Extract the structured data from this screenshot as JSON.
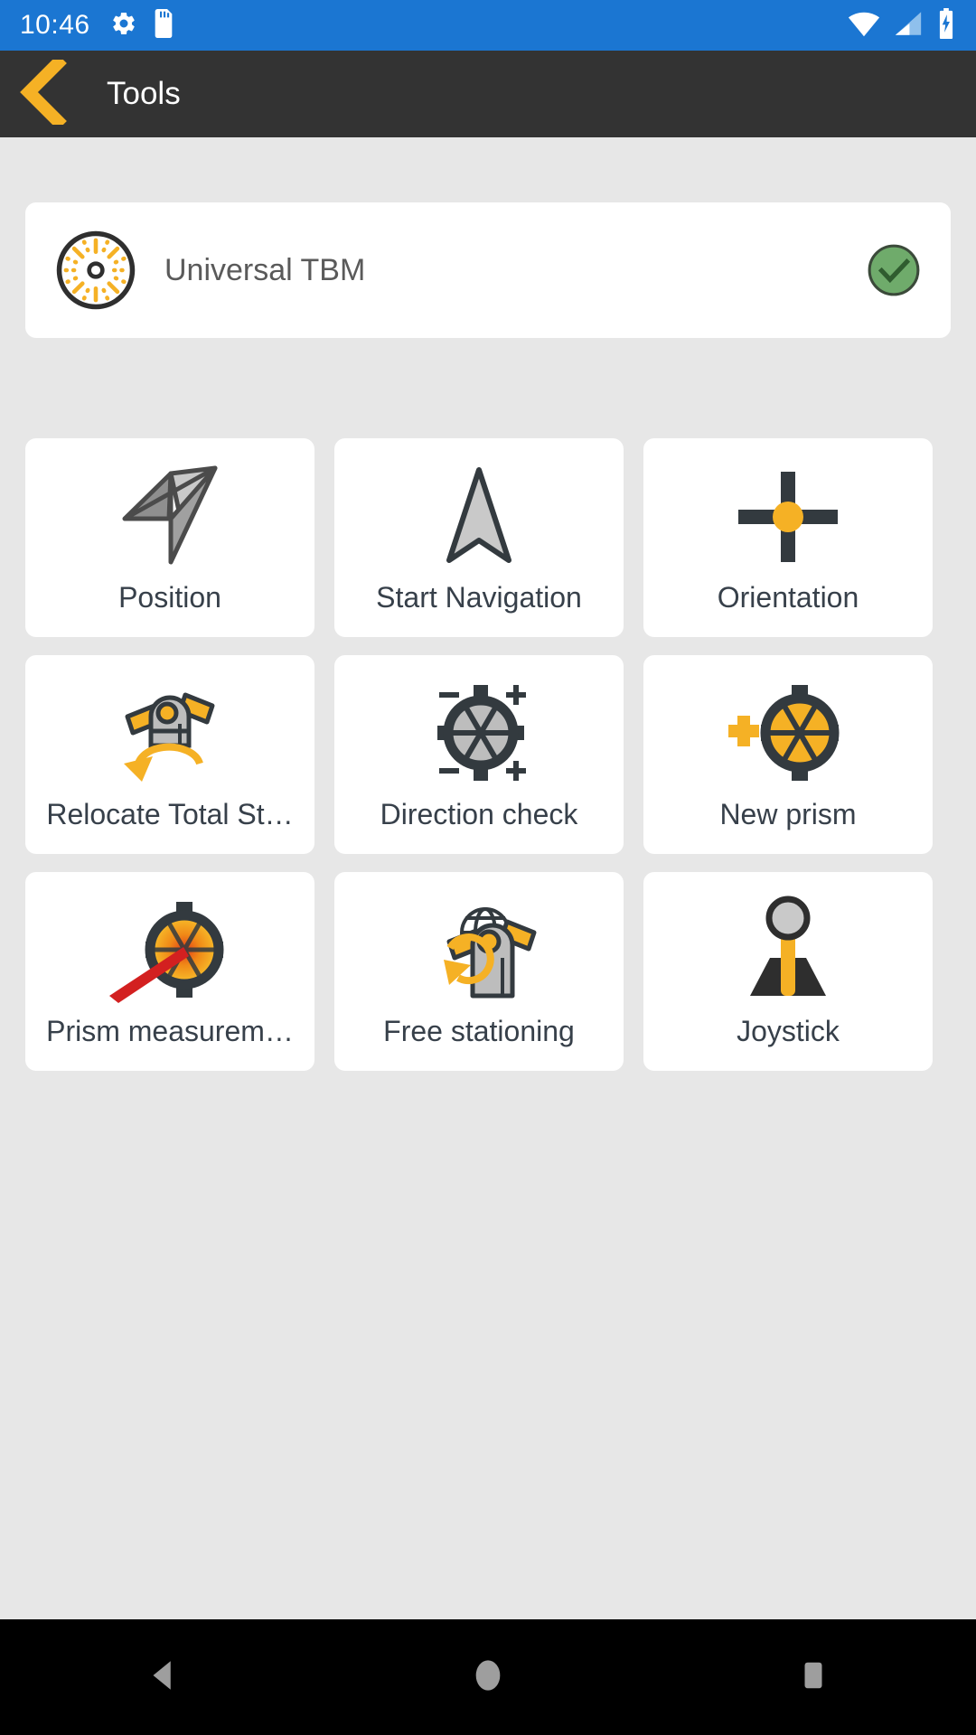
{
  "statusbar": {
    "time": "10:46",
    "left_icons": [
      "gear-icon",
      "sd-card-icon"
    ],
    "right_icons": [
      "wifi-icon",
      "cellular-signal-icon",
      "battery-charging-icon"
    ],
    "background_color": "#1b76d2",
    "wifi_level": "full",
    "cellular_bars": 2,
    "battery_charging": true
  },
  "toolbar": {
    "back_label": "back-chevron",
    "title": "Tools",
    "background_color": "#333333",
    "accent_color": "#f5b125"
  },
  "device": {
    "name": "Universal TBM",
    "icon": "tbm-cutterhead-icon",
    "status": "connected",
    "status_icon": "check-circle-icon",
    "status_color": "#6fab6b"
  },
  "tools": [
    {
      "label": "Position",
      "icon": "position-arrow-icon"
    },
    {
      "label": "Start Navigation",
      "icon": "navigation-arrow-icon"
    },
    {
      "label": "Orientation",
      "icon": "crosshair-icon"
    },
    {
      "label": "Relocate Total St…",
      "icon": "relocate-total-station-icon"
    },
    {
      "label": "Direction check",
      "icon": "direction-check-icon"
    },
    {
      "label": "New prism",
      "icon": "new-prism-icon"
    },
    {
      "label": "Prism measurem…",
      "icon": "prism-measurement-icon"
    },
    {
      "label": "Free stationing",
      "icon": "free-stationing-icon"
    },
    {
      "label": "Joystick",
      "icon": "joystick-icon"
    }
  ],
  "navbar": {
    "back": "nav-back-triangle",
    "home": "nav-home-circle",
    "recents": "nav-recents-square"
  },
  "colors": {
    "page_background": "#e7e7e7",
    "card_background": "#ffffff",
    "accent_yellow": "#f5b125",
    "label_text": "#37404a",
    "device_text": "#5a5a5a",
    "icon_dark": "#333a3f",
    "icon_gray": "#bdbdbd"
  }
}
